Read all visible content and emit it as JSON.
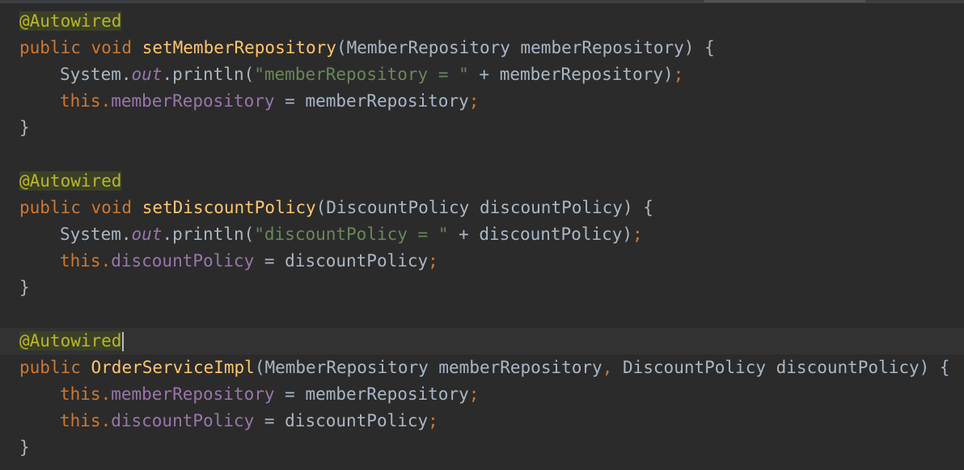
{
  "editor": {
    "blocks": [
      {
        "annotation": "@Autowired",
        "signature": {
          "mods": "public void ",
          "name": "setMemberRepository",
          "params": "(MemberRepository memberRepository) {"
        },
        "body": [
          {
            "kind": "print",
            "recv": "System.",
            "out": "out",
            "call": ".println(",
            "str": "\"memberRepository = \"",
            "rest": " + memberRepository)",
            "semi": ";"
          },
          {
            "kind": "assign",
            "this": "this.",
            "field": "memberRepository",
            "rest": " = memberRepository",
            "semi": ";"
          }
        ],
        "close": "}"
      },
      {
        "annotation": "@Autowired",
        "signature": {
          "mods": "public void ",
          "name": "setDiscountPolicy",
          "params": "(DiscountPolicy discountPolicy) {"
        },
        "body": [
          {
            "kind": "print",
            "recv": "System.",
            "out": "out",
            "call": ".println(",
            "str": "\"discountPolicy = \"",
            "rest": " + discountPolicy)",
            "semi": ";"
          },
          {
            "kind": "assign",
            "this": "this.",
            "field": "discountPolicy",
            "rest": " = discountPolicy",
            "semi": ";"
          }
        ],
        "close": "}"
      },
      {
        "annotation": "@Autowired",
        "signature": {
          "mods": "public ",
          "name": "OrderServiceImpl",
          "params_a": "(MemberRepository memberRepository",
          "comma": ",",
          "params_b": " DiscountPolicy discountPolicy) {"
        },
        "body": [
          {
            "kind": "assign",
            "this": "this.",
            "field": "memberRepository",
            "rest": " = memberRepository",
            "semi": ";"
          },
          {
            "kind": "assign",
            "this": "this.",
            "field": "discountPolicy",
            "rest": " = discountPolicy",
            "semi": ";"
          }
        ],
        "close": "}"
      }
    ]
  },
  "colors": {
    "background": "#2b2b2b",
    "keyword": "#cc7832",
    "annotation": "#bbb529",
    "method_name": "#ffc66d",
    "string": "#6a8759",
    "field": "#9876aa",
    "plain": "#a9b7c6"
  }
}
